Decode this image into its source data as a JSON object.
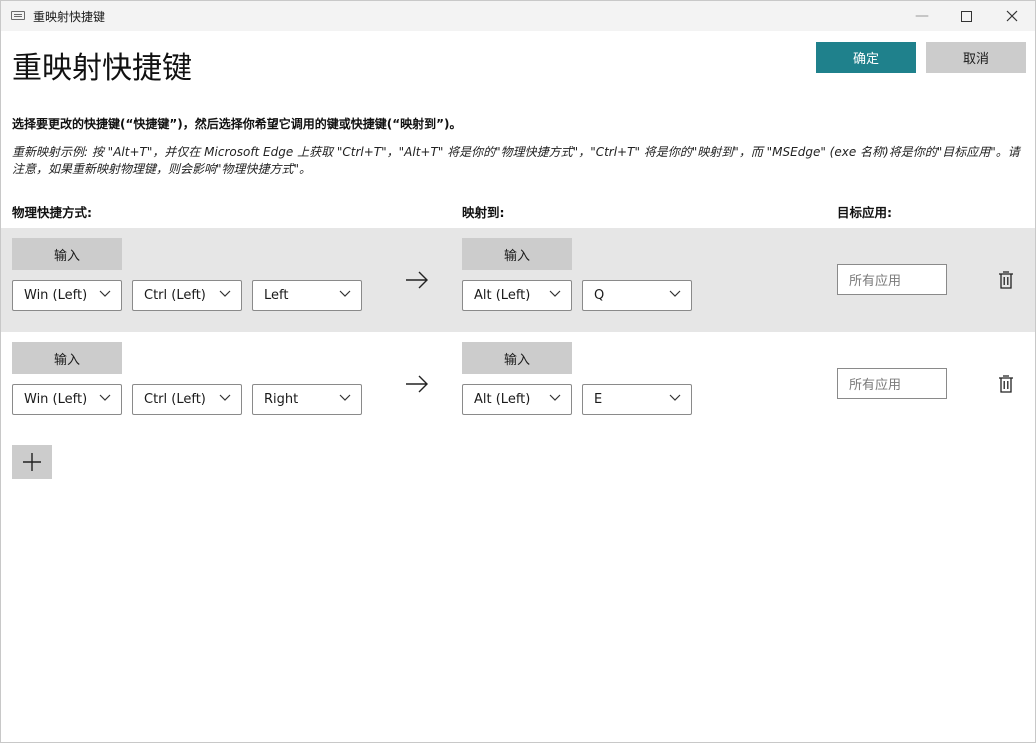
{
  "window": {
    "title": "重映射快捷键",
    "icons": [
      "keyboard-icon",
      "minimize-icon",
      "maximize-icon",
      "close-icon"
    ]
  },
  "header": {
    "title": "重映射快捷键",
    "ok_label": "确定",
    "cancel_label": "取消"
  },
  "description": {
    "line1": "选择要更改的快捷键(“快捷键”)，然后选择你希望它调用的键或快捷键(“映射到”)。",
    "line2": "重新映射示例: 按 \"Alt+T\"，并仅在 Microsoft Edge 上获取 \"Ctrl+T\"，\"Alt+T\" 将是你的\"物理快捷方式\"，\"Ctrl+T\" 将是你的\"映射到\"，而 \"MSEdge\" (exe 名称)将是你的\"目标应用\"。请注意，如果重新映射物理键，则会影响\"物理快捷方式\"。"
  },
  "columns": {
    "physical": "物理快捷方式:",
    "mapped": "映射到:",
    "target_app": "目标应用:"
  },
  "rows": [
    {
      "input_label": "输入",
      "physical": [
        "Win (Left)",
        "Ctrl (Left)",
        "Left"
      ],
      "mapped_input_label": "输入",
      "mapped": [
        "Alt (Left)",
        "Q"
      ],
      "app_placeholder": "所有应用"
    },
    {
      "input_label": "输入",
      "physical": [
        "Win (Left)",
        "Ctrl (Left)",
        "Right"
      ],
      "mapped_input_label": "输入",
      "mapped": [
        "Alt (Left)",
        "E"
      ],
      "app_placeholder": "所有应用"
    }
  ],
  "colors": {
    "accent": "#1f818c",
    "button_gray": "#cccccc",
    "row_shade": "#e6e6e6",
    "titlebar": "#f3f3f3"
  }
}
